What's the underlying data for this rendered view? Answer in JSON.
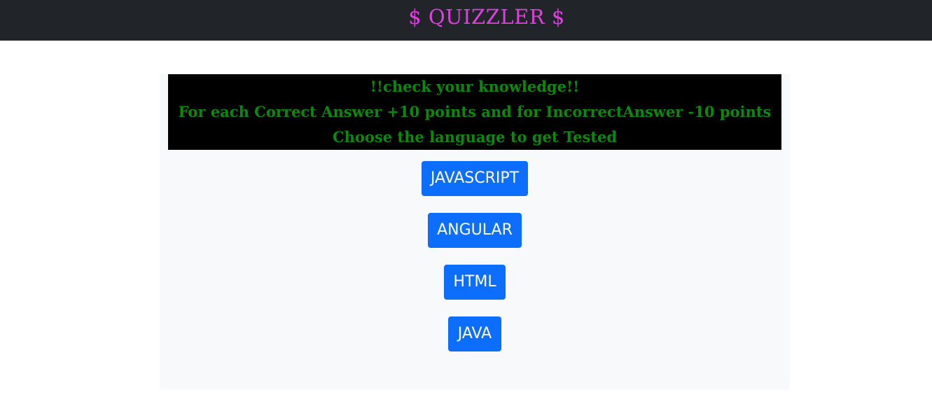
{
  "navbar": {
    "brand": "$ QUIZZLER $"
  },
  "banner": {
    "line1": "!!check your knowledge!!",
    "line2": "For each Correct Answer +10 points and for IncorrectAnswer -10 points",
    "line3": "Choose the language to get Tested"
  },
  "languages": [
    {
      "label": "JAVASCRIPT"
    },
    {
      "label": "ANGULAR"
    },
    {
      "label": "HTML"
    },
    {
      "label": "JAVA"
    }
  ],
  "colors": {
    "navbar_bg": "#212529",
    "brand_text": "#e040e0",
    "banner_bg": "#000000",
    "banner_text": "#0a8a0a",
    "button_bg": "#0d6efd",
    "panel_bg": "#f8f9fa"
  }
}
